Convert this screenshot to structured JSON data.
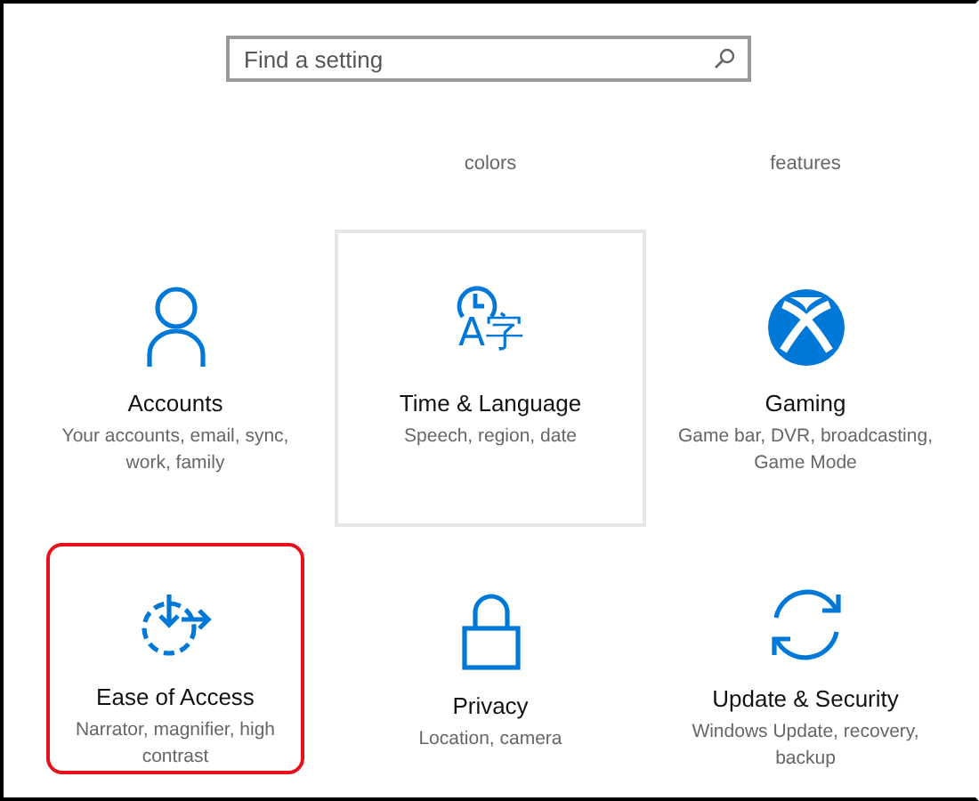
{
  "search": {
    "placeholder": "Find a setting"
  },
  "top_row": [
    {
      "text": "colors"
    },
    {
      "text": "features"
    }
  ],
  "tiles": [
    {
      "kind": "person",
      "title": "Accounts",
      "description": "Your accounts, email, sync, work, family",
      "hovered": false,
      "highlighted": false
    },
    {
      "kind": "language",
      "icon_glyph": "A字",
      "title": "Time & Language",
      "description": "Speech, region, date",
      "hovered": true,
      "highlighted": false
    },
    {
      "kind": "gaming",
      "title": "Gaming",
      "description": "Game bar, DVR, broadcasting, Game Mode",
      "hovered": false,
      "highlighted": false
    },
    {
      "kind": "access",
      "title": "Ease of Access",
      "description": "Narrator, magnifier, high contrast",
      "hovered": false,
      "highlighted": true
    },
    {
      "kind": "privacy",
      "title": "Privacy",
      "description": "Location, camera",
      "hovered": false,
      "highlighted": false
    },
    {
      "kind": "update",
      "title": "Update & Security",
      "description": "Windows Update, recovery, backup",
      "hovered": false,
      "highlighted": false
    }
  ]
}
